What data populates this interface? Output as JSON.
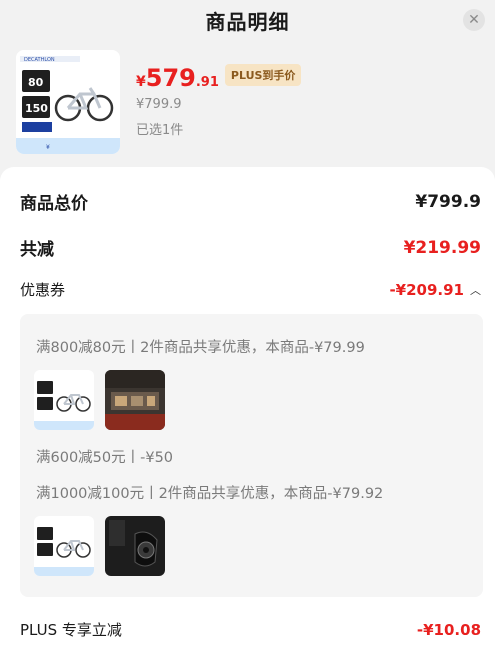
{
  "header": {
    "title": "商品明细"
  },
  "product": {
    "price_symbol": "¥",
    "price_integer": "579",
    "price_decimal": ".91",
    "plus_tag": "PLUS到手价",
    "original_price": "¥799.9",
    "selected_count": "已选1件",
    "image_labels": {
      "brand": "DECATHLON",
      "badge_top": "80",
      "badge_bottom": "150"
    }
  },
  "summary": {
    "total_label": "商品总价",
    "total_value": "¥799.9",
    "reduction_label": "共减",
    "reduction_value": "¥219.99",
    "coupon_label": "优惠券",
    "coupon_value": "-¥209.91"
  },
  "coupons": [
    {
      "text": "满800减80元丨2件商品共享优惠，本商品-¥79.99"
    },
    {
      "text": "满600减50元丨-¥50"
    },
    {
      "text": "满1000减100元丨2件商品共享优惠，本商品-¥79.92"
    }
  ],
  "plus": {
    "label": "PLUS 专享立减",
    "value": "-¥10.08"
  },
  "colors": {
    "accent_red": "#e8201f",
    "plus_tag_bg": "#f7e4c4",
    "plus_tag_text": "#8b5a1e"
  }
}
